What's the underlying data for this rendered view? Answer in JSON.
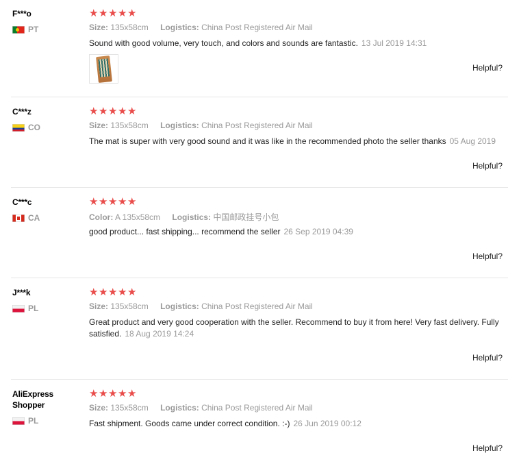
{
  "labels": {
    "size": "Size:",
    "color": "Color:",
    "logistics": "Logistics:",
    "helpful": "Helpful?"
  },
  "accent_star_color": "#e94d4b",
  "reviews": [
    {
      "user": "F***o",
      "country": "PT",
      "rating": 5,
      "attr_label": "Size:",
      "attr_value": "135x58cm",
      "logistics": "China Post Registered Air Mail",
      "text": "Sound with good volume, very touch, and colors and sounds are fantastic.",
      "date": "13 Jul 2019 14:31",
      "has_photo": true
    },
    {
      "user": "C***z",
      "country": "CO",
      "rating": 5,
      "attr_label": "Size:",
      "attr_value": "135x58cm",
      "logistics": "China Post Registered Air Mail",
      "text": "The mat is super with very good sound and it was like in the recommended photo the seller thanks",
      "date": "05 Aug 2019",
      "has_photo": false
    },
    {
      "user": "C***c",
      "country": "CA",
      "rating": 5,
      "attr_label": "Color:",
      "attr_value": "A 135x58cm",
      "logistics": "中国邮政挂号小包",
      "text": "good product... fast shipping... recommend the seller",
      "date": "26 Sep 2019 04:39",
      "has_photo": false
    },
    {
      "user": "J***k",
      "country": "PL",
      "rating": 5,
      "attr_label": "Size:",
      "attr_value": "135x58cm",
      "logistics": "China Post Registered Air Mail",
      "text": "Great product and very good cooperation with the seller. Recommend to buy it from here! Very fast delivery. Fully satisfied.",
      "date": "18 Aug 2019 14:24",
      "has_photo": false
    },
    {
      "user": "AliExpress Shopper",
      "country": "PL",
      "rating": 5,
      "attr_label": "Size:",
      "attr_value": "135x58cm",
      "logistics": "China Post Registered Air Mail",
      "text": "Fast shipment. Goods came under correct condition. :-)",
      "date": "26 Jun 2019 00:12",
      "has_photo": false
    }
  ]
}
